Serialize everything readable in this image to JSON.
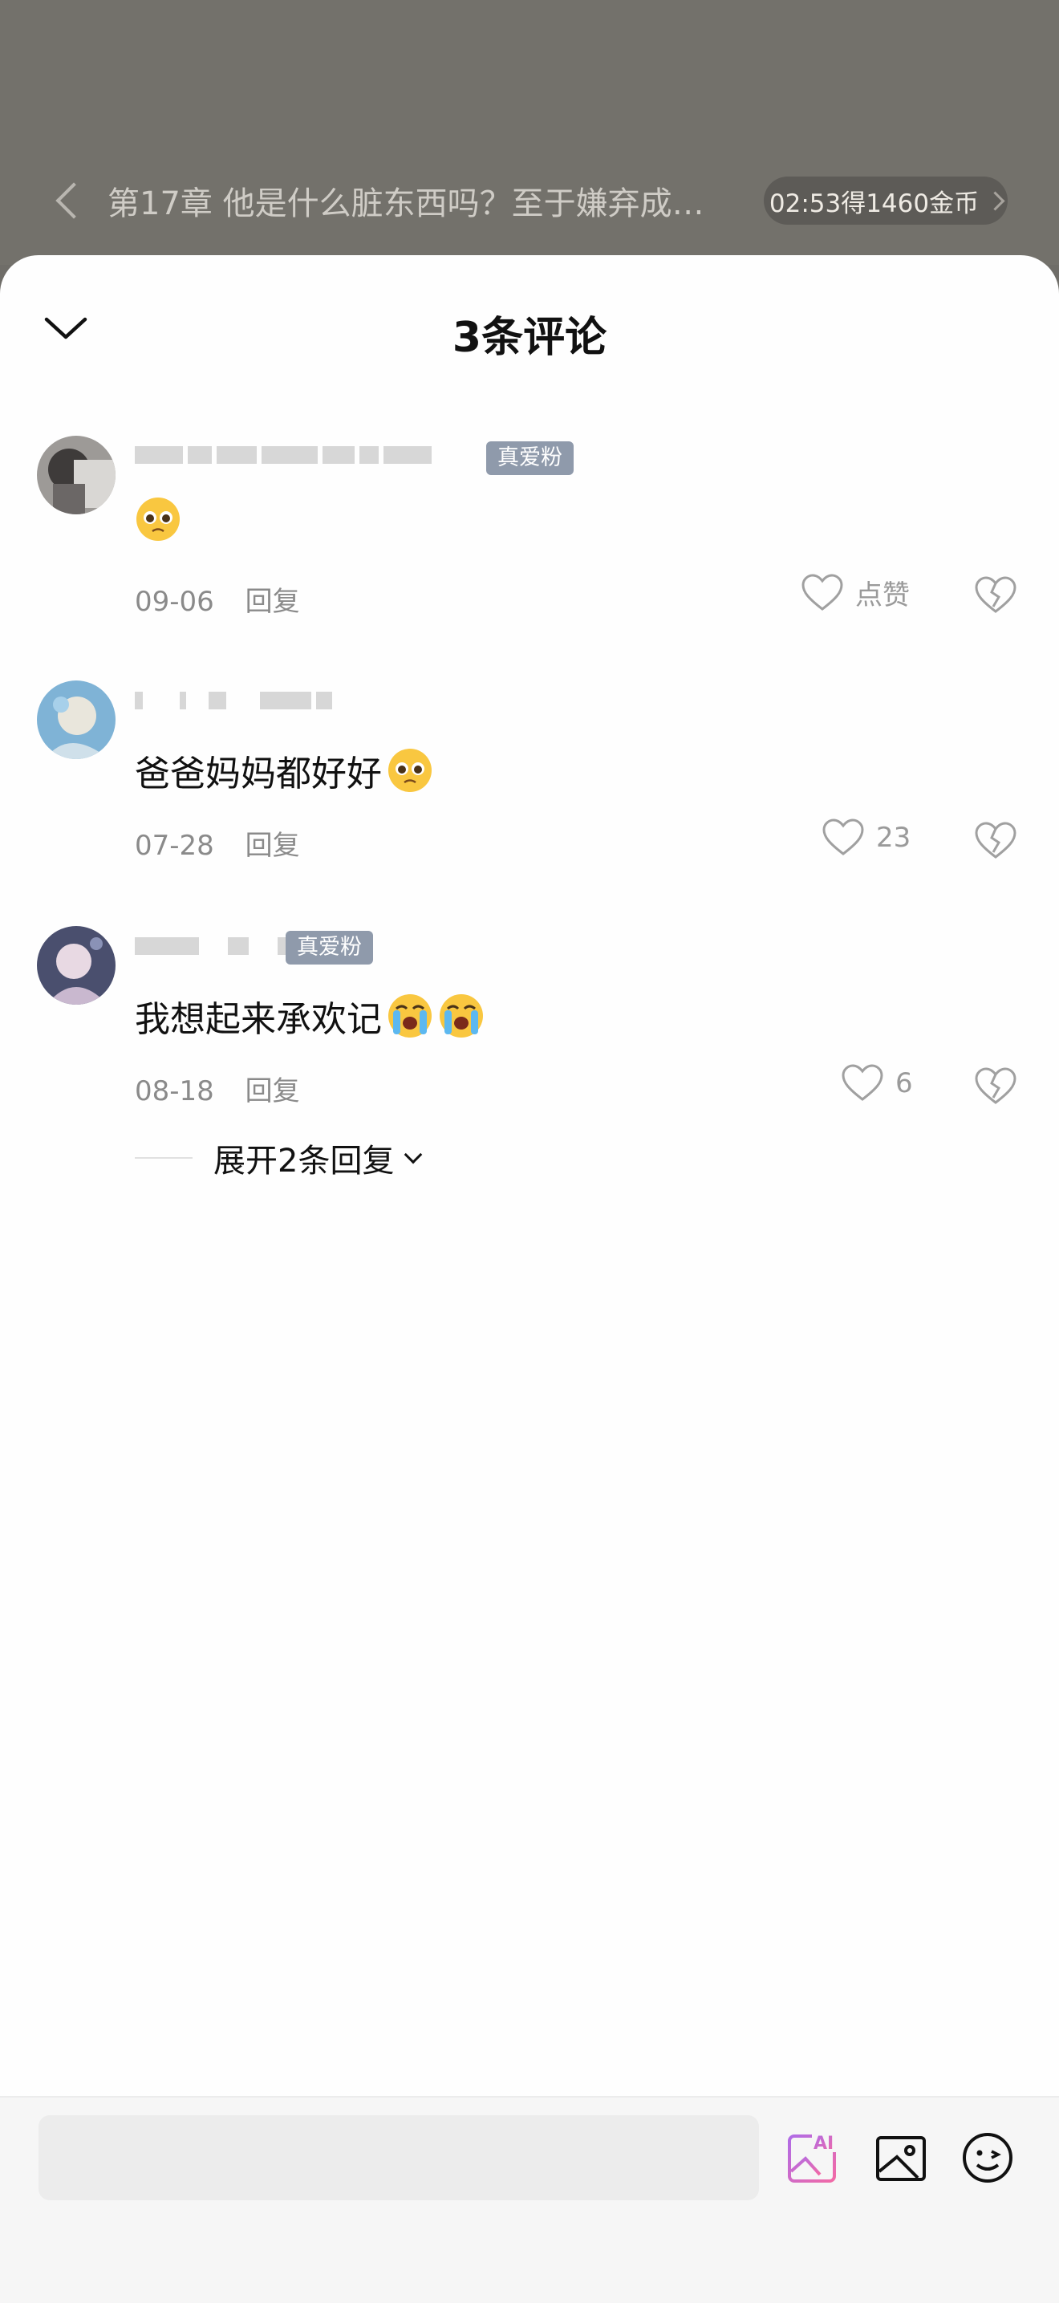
{
  "top_bar": {
    "chapter_title": "第17章 他是什么脏东西吗？至于嫌弃成…",
    "timer_reward": "02:53得1460金币"
  },
  "sheet": {
    "title": "3条评论"
  },
  "comments": [
    {
      "fan_badge": "真爱粉",
      "text": "",
      "emojis": [
        "pleading-face-emoji"
      ],
      "date": "09-06",
      "reply_label": "回复",
      "likes": "点赞"
    },
    {
      "fan_badge": "",
      "text": "爸爸妈妈都好好",
      "emojis": [
        "pleading-face-emoji"
      ],
      "date": "07-28",
      "reply_label": "回复",
      "likes": "23"
    },
    {
      "fan_badge": "真爱粉",
      "text": "我想起来承欢记",
      "emojis": [
        "loudly-crying-face-emoji",
        "loudly-crying-face-emoji"
      ],
      "date": "08-18",
      "reply_label": "回复",
      "likes": "6"
    }
  ],
  "expand_replies": "展开2条回复",
  "bottom_bar": {
    "input_placeholder": "",
    "tools": [
      "ai-image-icon",
      "image-icon",
      "emoji-icon"
    ]
  },
  "colors": {
    "accent_ai": "#d95bd6",
    "fan_badge": "#8f9aab"
  }
}
